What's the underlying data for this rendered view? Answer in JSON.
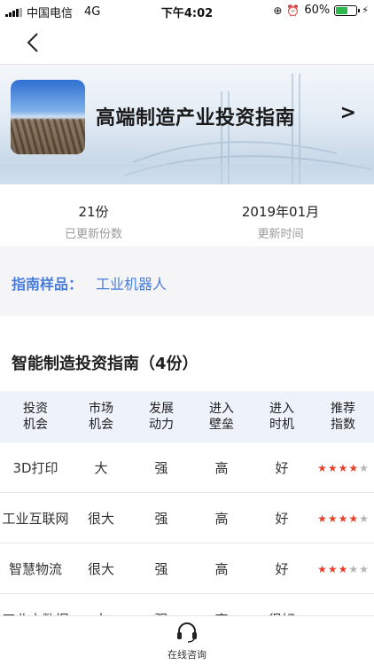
{
  "status_bar": {
    "carrier": "中国电信",
    "network": "4G",
    "time": "下午4:02",
    "battery_percent": "60%",
    "battery_level": 0.6
  },
  "nav": {
    "back_icon": "chevron-left-icon"
  },
  "banner": {
    "title": "高端制造产业投资指南",
    "arrow": ">"
  },
  "stats": {
    "count_value": "21份",
    "count_label": "已更新份数",
    "time_value": "2019年01月",
    "time_label": "更新时间"
  },
  "sample": {
    "label": "指南样品：",
    "value": "工业机器人"
  },
  "section": {
    "title": "智能制造投资指南（4份）"
  },
  "table": {
    "headers": [
      {
        "line1": "投资",
        "line2": "机会"
      },
      {
        "line1": "市场",
        "line2": "机会"
      },
      {
        "line1": "发展",
        "line2": "动力"
      },
      {
        "line1": "进入",
        "line2": "壁垒"
      },
      {
        "line1": "进入",
        "line2": "时机"
      },
      {
        "line1": "推荐",
        "line2": "指数"
      }
    ],
    "rows": [
      {
        "opportunity": "3D打印",
        "market": "大",
        "drive": "强",
        "barrier": "高",
        "timing": "好",
        "rating": 4
      },
      {
        "opportunity": "工业互联网",
        "market": "很大",
        "drive": "强",
        "barrier": "高",
        "timing": "好",
        "rating": 4
      },
      {
        "opportunity": "智慧物流",
        "market": "很大",
        "drive": "强",
        "barrier": "高",
        "timing": "好",
        "rating": 3
      },
      {
        "opportunity": "工业大数据",
        "market": "大",
        "drive": "强",
        "barrier": "高",
        "timing": "很好",
        "rating": 0
      }
    ],
    "rating_max": 5,
    "colors": {
      "star_on": "#e8402a",
      "star_off": "#b5b5b5"
    }
  },
  "bottom_bar": {
    "consult_label": "在线咨询",
    "consult_icon": "headset-icon"
  }
}
